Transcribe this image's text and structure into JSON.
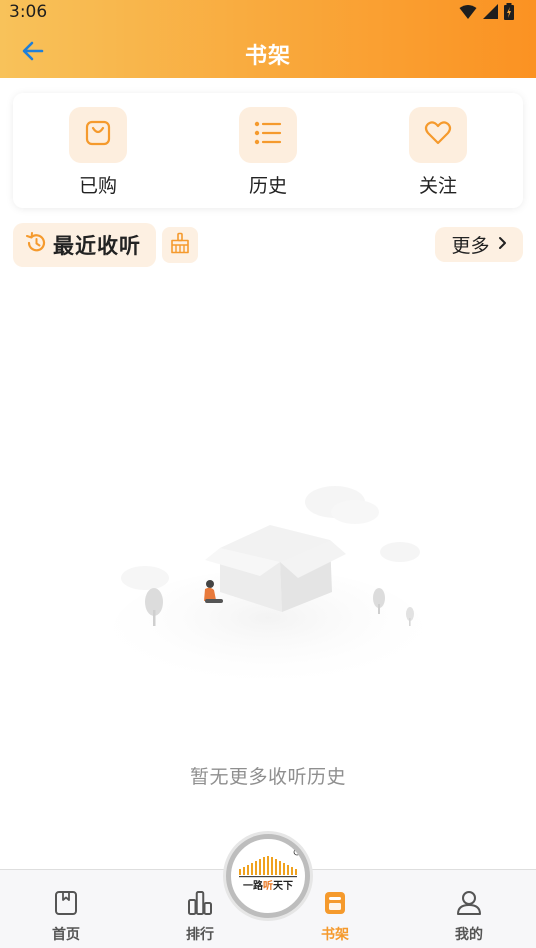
{
  "status_bar": {
    "time": "3:06"
  },
  "nav": {
    "title": "书架"
  },
  "quick_actions": [
    {
      "label": "已购",
      "icon": "shopping-bag-icon"
    },
    {
      "label": "历史",
      "icon": "list-icon"
    },
    {
      "label": "关注",
      "icon": "heart-icon"
    }
  ],
  "recent": {
    "title": "最近收听",
    "more_label": "更多",
    "empty_text": "暂无更多收听历史"
  },
  "center_logo": {
    "text": "一路听天下"
  },
  "bottom_nav": [
    {
      "label": "首页",
      "icon": "bookmark-icon",
      "active": false
    },
    {
      "label": "排行",
      "icon": "bar-chart-icon",
      "active": false
    },
    {
      "label": "书架",
      "icon": "bookshelf-icon",
      "active": true
    },
    {
      "label": "我的",
      "icon": "user-icon",
      "active": false
    }
  ],
  "colors": {
    "accent": "#f59a2d",
    "header_start": "#f8c25a",
    "header_end": "#fb9222",
    "back_arrow": "#1e7fd9",
    "icon_bg": "#fdeede"
  }
}
